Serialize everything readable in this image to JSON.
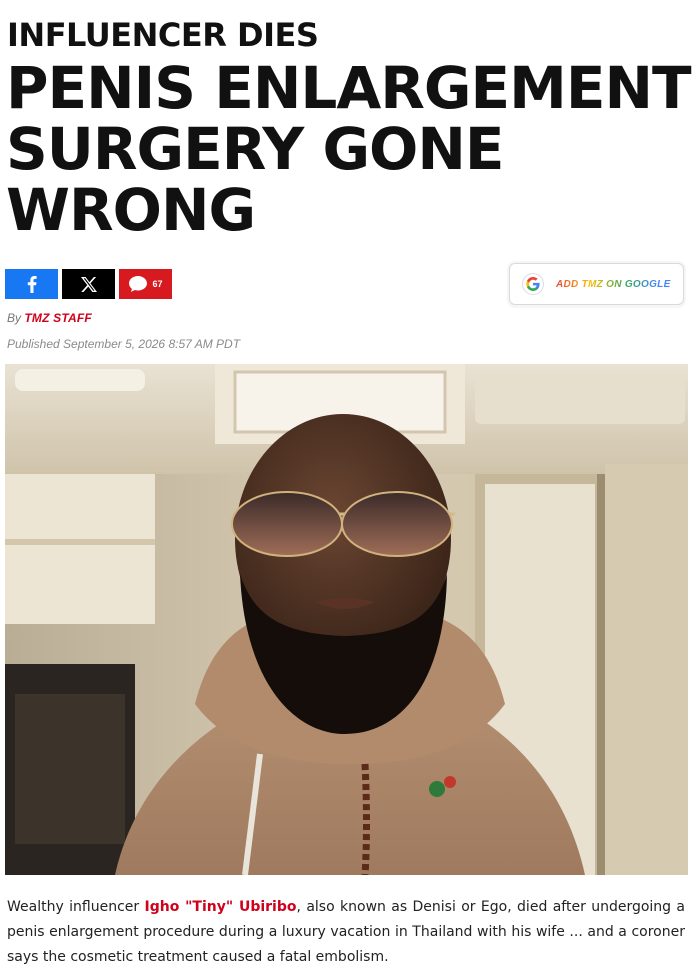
{
  "article": {
    "kicker": "INFLUENCER DIES",
    "headline_lines": [
      "PENIS ENLARGEMENT",
      "SURGERY GONE",
      "WRONG"
    ],
    "byline_prefix": "By",
    "author": "TMZ STAFF",
    "published": "Published September 5, 2026 8:57 AM PDT",
    "body": {
      "before_link": "Wealthy influencer ",
      "link_text": "Igho \"Tiny\" Ubiribo",
      "after_link": ", also known as Denisi or Ego, died after undergoing a penis enlargement procedure during a luxury vacation in Thailand with his wife ... and a coroner says the cosmetic treatment caused a fatal embolism."
    }
  },
  "share": {
    "facebook_icon": "facebook-icon",
    "x_icon": "x-icon",
    "comment_icon": "comment-icon",
    "comment_count": "67"
  },
  "google_button": {
    "icon": "google-g-icon",
    "label": "ADD TMZ ON GOOGLE"
  },
  "colors": {
    "accent_red": "#d0021b",
    "facebook": "#1877f2",
    "x": "#000000",
    "comments": "#d71920"
  }
}
